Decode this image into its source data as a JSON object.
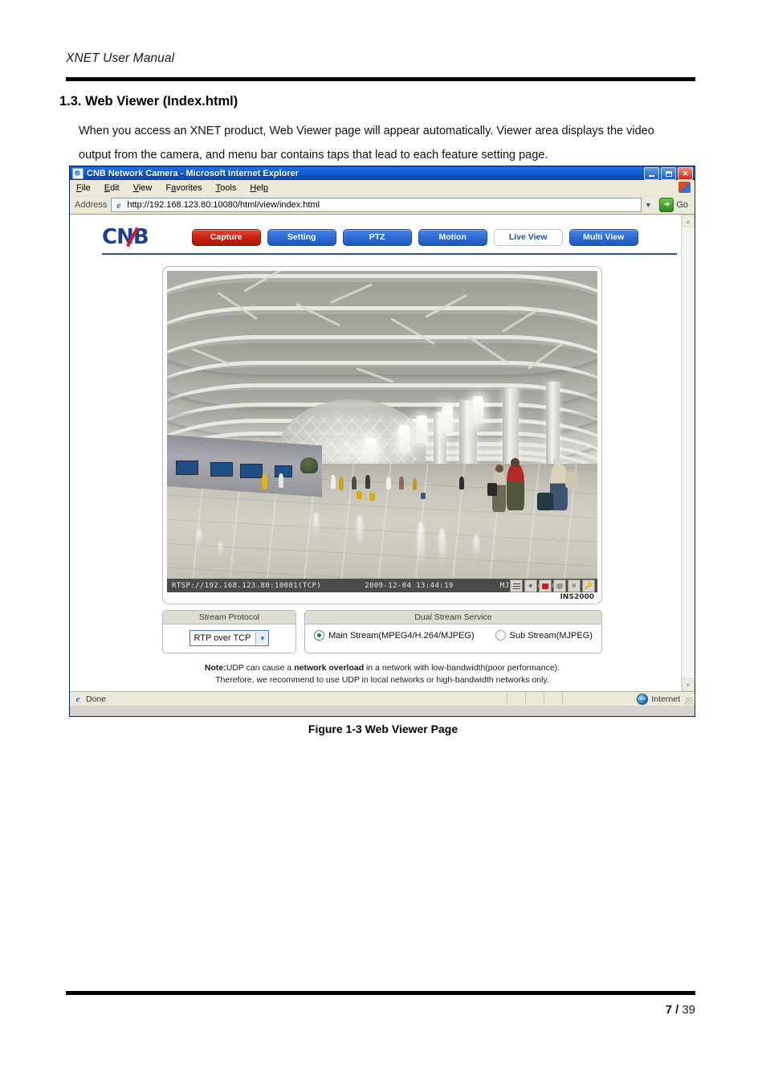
{
  "document": {
    "running_header": "XNET User Manual",
    "section_title": "1.3. Web Viewer (Index.html)",
    "body_paragraph": "When you access an XNET product, Web Viewer page will appear automatically. Viewer area displays the video output from the camera, and menu bar contains taps that lead to each feature setting page.",
    "figure_caption": "Figure 1-3 Web Viewer Page",
    "page_number": "7",
    "page_separator": "/",
    "page_total": "39"
  },
  "browser": {
    "title": "CNB Network Camera - Microsoft Internet Explorer",
    "window_buttons": {
      "minimize": "Minimize",
      "maximize": "Maximize",
      "close": "Close"
    },
    "menu_items": [
      "File",
      "Edit",
      "View",
      "Favorites",
      "Tools",
      "Help"
    ],
    "address": {
      "label": "Address",
      "url": "http://192.168.123.80:10080/html/view/index.html",
      "go_label": "Go"
    },
    "status": {
      "text": "Done",
      "zone": "Internet"
    }
  },
  "webpage": {
    "logo": "CNB",
    "nav_buttons": [
      {
        "label": "Capture",
        "style": "capture"
      },
      {
        "label": "Setting",
        "style": "normal"
      },
      {
        "label": "PTZ",
        "style": "normal"
      },
      {
        "label": "Motion",
        "style": "normal"
      },
      {
        "label": "Live View",
        "style": "active"
      },
      {
        "label": "Multi View",
        "style": "normal"
      }
    ],
    "video_osd": {
      "rtsp": "RTSP://192.168.123.80:10081(TCP)",
      "datetime": "2009-12-04 13:44:19",
      "codec": "MJPEG, 640x480",
      "icons": [
        "video-lines-icon",
        "pan-tilt-icon",
        "record-icon",
        "snapshot-icon",
        "network-block-icon",
        "auth-key-icon"
      ],
      "device_label": "INS2000"
    },
    "stream_protocol": {
      "legend": "Stream Protocol",
      "selected": "RTP over TCP"
    },
    "dual_stream": {
      "legend": "Dual Stream Service",
      "options": [
        {
          "label": "Main Stream(MPEG4/H.264/MJPEG)",
          "selected": true
        },
        {
          "label": "Sub Stream(MJPEG)",
          "selected": false
        }
      ]
    },
    "note": {
      "prefix": "Note:",
      "line1_a": "UDP can cause a ",
      "line1_bold": "network overload",
      "line1_b": " in a network with low-bandwidth(poor performance).",
      "line2": "Therefore, we recommend to use UDP in local networks or high-bandwidth networks only."
    }
  },
  "colors": {
    "nav_blue": "#2f6fd8",
    "nav_red": "#cc2414",
    "logo_blue": "#1f3f8f",
    "logo_red": "#cc1f27",
    "title_blue": "#0f5bd4"
  }
}
